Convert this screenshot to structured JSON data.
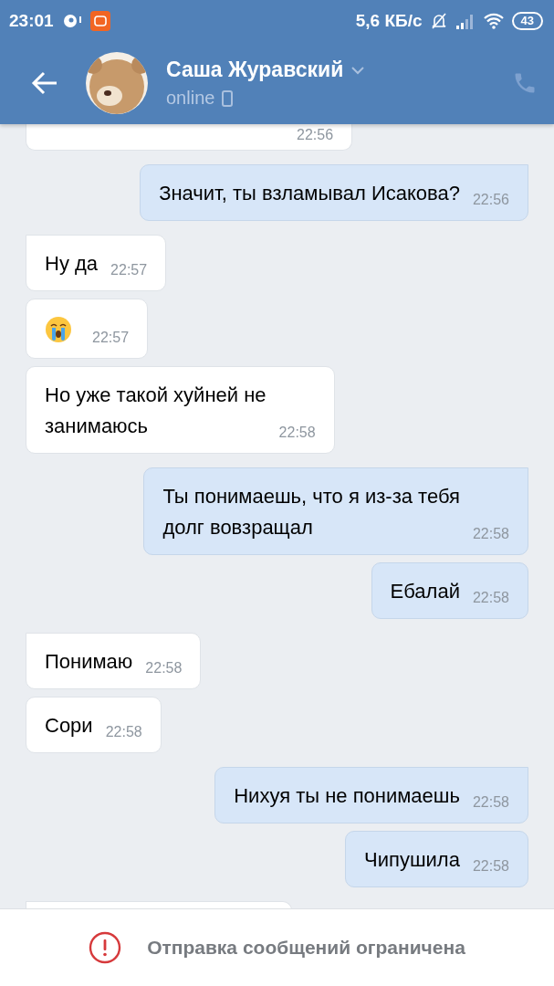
{
  "status_bar": {
    "time": "23:01",
    "speed": "5,6 КБ/с",
    "battery": "43"
  },
  "header": {
    "name": "Саша Журавский",
    "status": "online"
  },
  "messages": [
    {
      "kind": "in",
      "tail": false,
      "cut": true,
      "time": "22:56"
    },
    {
      "kind": "out",
      "tail": true,
      "text": "Значит, ты взламывал Исакова?",
      "time": "22:56"
    },
    {
      "kind": "in",
      "tail": true,
      "text": "Ну да",
      "time": "22:57"
    },
    {
      "kind": "emoji",
      "tail": false,
      "time": "22:57"
    },
    {
      "kind": "in",
      "tail": false,
      "text": "Но уже такой хуйней не\nзанимаюсь",
      "time": "22:58"
    },
    {
      "kind": "out",
      "tail": true,
      "text": "Ты понимаешь, что я из-за тебя\nдолг вовзращал",
      "time": "22:58"
    },
    {
      "kind": "out",
      "tail": false,
      "text": "Ебалай",
      "time": "22:58"
    },
    {
      "kind": "in",
      "tail": true,
      "text": "Понимаю",
      "time": "22:58"
    },
    {
      "kind": "in",
      "tail": false,
      "text": "Сори",
      "time": "22:58"
    },
    {
      "kind": "out",
      "tail": true,
      "text": "Нихуя ты не понимаешь",
      "time": "22:58"
    },
    {
      "kind": "out",
      "tail": false,
      "text": "Чипушила",
      "time": "22:58"
    },
    {
      "kind": "stub",
      "tail": true
    }
  ],
  "footer": {
    "notice": "Отправка сообщений ограничена"
  }
}
